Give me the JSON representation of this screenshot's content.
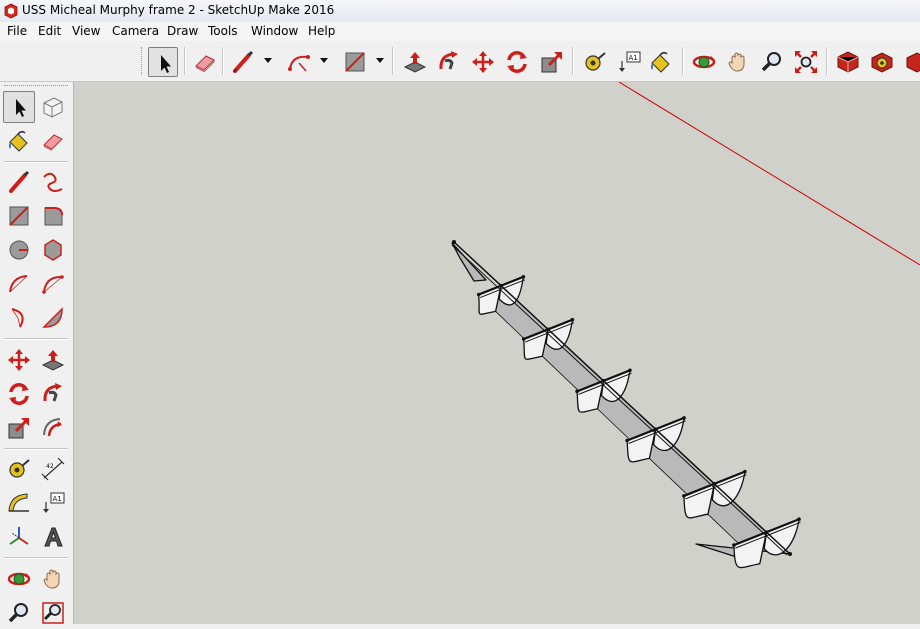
{
  "window": {
    "title": "USS Micheal Murphy frame 2 - SketchUp Make 2016",
    "app_icon": "sketchup-logo-icon"
  },
  "menu": [
    "File",
    "Edit",
    "View",
    "Camera",
    "Draw",
    "Tools",
    "Window",
    "Help"
  ],
  "top_toolbar": [
    "select-tool-icon",
    "eraser-tool-icon",
    "line-tool-icon",
    "arc-tool-icon",
    "rectangle-tool-icon",
    "push-pull-tool-icon",
    "follow-me-tool-icon",
    "move-tool-icon",
    "rotate-tool-icon",
    "scale-tool-icon",
    "tape-measure-tool-icon",
    "text-tool-icon",
    "paint-bucket-tool-icon",
    "orbit-tool-icon",
    "pan-tool-icon",
    "zoom-tool-icon",
    "zoom-extents-tool-icon",
    "3d-warehouse-icon",
    "extension-warehouse-icon"
  ],
  "left_toolbar": [
    "select-tool-icon",
    "make-component-icon",
    "paint-bucket-tool-icon",
    "eraser-tool-icon",
    "line-tool-icon",
    "freehand-tool-icon",
    "rectangle-tool-icon",
    "rotated-rectangle-icon",
    "circle-tool-icon",
    "polygon-tool-icon",
    "arc-tool-icon",
    "two-point-arc-icon",
    "three-point-arc-icon",
    "pie-tool-icon",
    "move-tool-icon",
    "push-pull-tool-icon",
    "rotate-tool-icon",
    "follow-me-tool-icon",
    "scale-tool-icon",
    "offset-tool-icon",
    "tape-measure-tool-icon",
    "dimension-tool-icon",
    "protractor-tool-icon",
    "text-tool-icon",
    "axes-tool-icon",
    "3d-text-tool-icon",
    "orbit-tool-icon",
    "pan-tool-icon",
    "zoom-tool-icon",
    "zoom-window-icon"
  ],
  "colors": {
    "viewport_bg": "#d1d1cc",
    "red_axis": "#cc0000",
    "face_light": "#f3f3f3",
    "face_dark": "#b9b9b9"
  }
}
